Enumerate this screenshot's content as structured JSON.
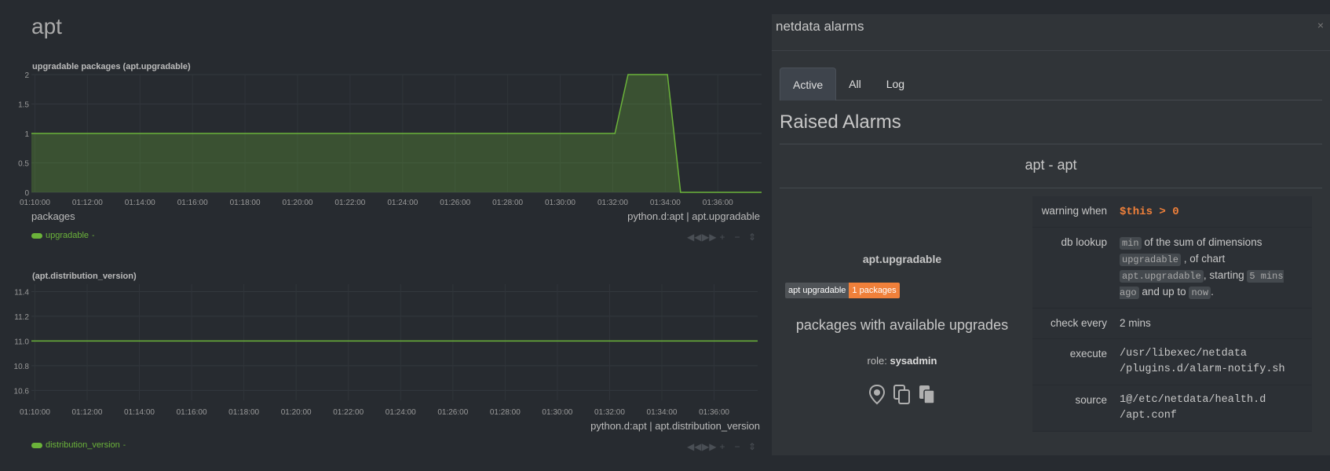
{
  "page": {
    "title": "apt"
  },
  "charts": [
    {
      "title": "upgradable packages (apt.upgradable)",
      "units": "packages",
      "source": "python.d:apt | apt.upgradable",
      "legend": {
        "label": "upgradable",
        "value": "-"
      },
      "color": "#6bb33a"
    },
    {
      "title": "(apt.distribution_version)",
      "units": "",
      "source": "python.d:apt | apt.distribution_version",
      "legend": {
        "label": "distribution_version",
        "value": "-"
      },
      "color": "#6bb33a"
    }
  ],
  "chart_data": [
    {
      "type": "area",
      "title": "upgradable packages (apt.upgradable)",
      "xlabel": "",
      "ylabel": "packages",
      "x_ticks": [
        "01:10:00",
        "01:12:00",
        "01:14:00",
        "01:16:00",
        "01:18:00",
        "01:20:00",
        "01:22:00",
        "01:24:00",
        "01:26:00",
        "01:28:00",
        "01:30:00",
        "01:32:00",
        "01:34:00",
        "01:36:00"
      ],
      "y_ticks": [
        "0",
        "0.5",
        "1",
        "1.5",
        "2"
      ],
      "ylim": [
        0,
        2
      ],
      "xlim": [
        "01:09:52",
        "01:37:40"
      ],
      "series": [
        {
          "name": "upgradable",
          "color": "#6bb33a",
          "points": [
            [
              "01:09:52",
              1
            ],
            [
              "01:32:05",
              1
            ],
            [
              "01:32:35",
              2
            ],
            [
              "01:34:05",
              2
            ],
            [
              "01:34:35",
              0
            ],
            [
              "01:37:40",
              0
            ]
          ]
        }
      ],
      "grid": true
    },
    {
      "type": "line",
      "title": "(apt.distribution_version)",
      "xlabel": "",
      "ylabel": "",
      "x_ticks": [
        "01:10:00",
        "01:12:00",
        "01:14:00",
        "01:16:00",
        "01:18:00",
        "01:20:00",
        "01:22:00",
        "01:24:00",
        "01:26:00",
        "01:28:00",
        "01:30:00",
        "01:32:00",
        "01:34:00",
        "01:36:00"
      ],
      "y_ticks": [
        "10.6",
        "10.8",
        "11.0",
        "11.2",
        "11.4"
      ],
      "ylim": [
        10.52,
        11.46
      ],
      "xlim": [
        "01:09:52",
        "01:37:40"
      ],
      "series": [
        {
          "name": "distribution_version",
          "color": "#6bb33a",
          "points": [
            [
              "01:09:52",
              11.0
            ],
            [
              "01:37:40",
              11.0
            ]
          ]
        }
      ],
      "grid": true
    }
  ],
  "alarms_modal": {
    "title": "netdata alarms",
    "close": "×",
    "tabs": [
      {
        "label": "Active"
      },
      {
        "label": "All"
      },
      {
        "label": "Log"
      }
    ],
    "section_title": "Raised Alarms",
    "group_title": "apt - apt",
    "alarm": {
      "name": "apt.upgradable",
      "badge_label": "apt upgradable",
      "badge_value": "1 packages",
      "info": "packages with available upgrades",
      "role_label": "role:",
      "role": "sysadmin",
      "icons": [
        "map-pin-icon",
        "copy-icon",
        "paste-icon"
      ],
      "rows": {
        "warning_label": "warning when",
        "warning_value": "$this > 0",
        "db_label": "db lookup",
        "db_method": "min",
        "db_text1": "of the sum of dimensions",
        "db_dimensions": "upgradable",
        "db_text2": ", of chart",
        "db_chart": "apt.upgradable",
        "db_text3": ", starting",
        "db_after": "5 mins ago",
        "db_text4": "and up to",
        "db_before": "now",
        "db_text5": ".",
        "check_label": "check every",
        "check_value": "2 mins",
        "execute_label": "execute",
        "execute_value_1": "/usr/libexec/netdata",
        "execute_value_2": "/plugins.d/alarm-notify.sh",
        "source_label": "source",
        "source_value_1": "1@/etc/netdata/health.d",
        "source_value_2": "/apt.conf"
      }
    }
  }
}
